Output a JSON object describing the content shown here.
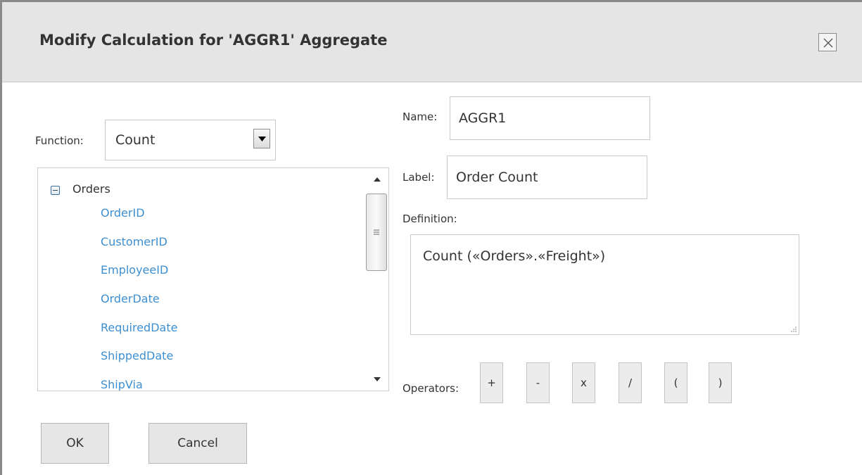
{
  "dialog": {
    "title": "Modify Calculation for 'AGGR1' Aggregate",
    "close_icon": "close-icon"
  },
  "function": {
    "label": "Function:",
    "selected": "Count",
    "dropdown_icon": "chevron-down-icon"
  },
  "tree": {
    "root": {
      "label": "Orders",
      "expanded": true,
      "icon": "collapse-icon"
    },
    "fields": [
      "OrderID",
      "CustomerID",
      "EmployeeID",
      "OrderDate",
      "RequiredDate",
      "ShippedDate",
      "ShipVia"
    ]
  },
  "name": {
    "label": "Name:",
    "value": "AGGR1"
  },
  "label_field": {
    "label": "Label:",
    "value": "Order Count"
  },
  "definition": {
    "label": "Definition:",
    "value": "Count («Orders».«Freight»)"
  },
  "operators": {
    "label": "Operators:",
    "items": [
      "+",
      "-",
      "x",
      "/",
      "(",
      ")"
    ]
  },
  "footer": {
    "ok_label": "OK",
    "cancel_label": "Cancel"
  },
  "colors": {
    "titlebar": "#e5e5e5",
    "field_link": "#3e8fd0",
    "button_bg": "#e6e6e6",
    "border": "#c9c9c9"
  }
}
